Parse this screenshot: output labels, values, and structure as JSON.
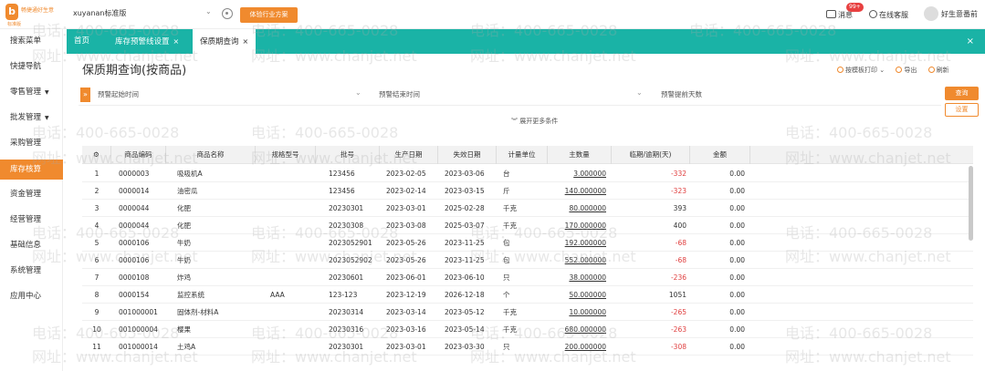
{
  "header": {
    "logo_text": "畅捷通好生意",
    "logo_sub": "标准版",
    "account": "xuyanan标准版",
    "plan_button": "体验行业方案",
    "messages_label": "消息",
    "messages_badge": "99+",
    "online_label": "在线客服",
    "user_label": "好生意番前"
  },
  "sidebar": {
    "items": [
      {
        "label": "搜索菜单"
      },
      {
        "label": "快捷导航"
      },
      {
        "label": "零售管理"
      },
      {
        "label": "批发管理"
      },
      {
        "label": "采购管理"
      },
      {
        "label": "库存核算"
      },
      {
        "label": "资金管理"
      },
      {
        "label": "经营管理"
      },
      {
        "label": "基础信息"
      },
      {
        "label": "系统管理"
      },
      {
        "label": "应用中心"
      }
    ]
  },
  "tabs": {
    "home": "首页",
    "tab1": "库存预警线设置",
    "tab2": "保质期查询",
    "close_glyph": "×"
  },
  "page": {
    "title": "保质期查询(按商品)",
    "print_label": "按模板打印",
    "export_label": "导出",
    "refresh_label": "刷新"
  },
  "filters": {
    "start_time": "预警起始时间",
    "end_time": "预警结束时间",
    "days_ahead": "预警提前天数",
    "query": "查询",
    "settings": "设置",
    "expand": "展开更多条件"
  },
  "table": {
    "headers": [
      "商品编码",
      "商品名称",
      "规格型号",
      "批号",
      "生产日期",
      "失效日期",
      "计量单位",
      "主数量",
      "临期/逾期(天)",
      "金额"
    ],
    "rows": [
      {
        "no": "1",
        "code": "0000003",
        "name": "吸吸机A",
        "spec": "",
        "batch": "123456",
        "mfg": "2023-02-05",
        "exp": "2023-03-06",
        "unit": "台",
        "qty": "3.000000",
        "days": "-332",
        "amount": "0.00"
      },
      {
        "no": "2",
        "code": "0000014",
        "name": "油密瓜",
        "spec": "",
        "batch": "123456",
        "mfg": "2023-02-14",
        "exp": "2023-03-15",
        "unit": "斤",
        "qty": "140.000000",
        "days": "-323",
        "amount": "0.00"
      },
      {
        "no": "3",
        "code": "0000044",
        "name": "化肥",
        "spec": "",
        "batch": "20230301",
        "mfg": "2023-03-01",
        "exp": "2025-02-28",
        "unit": "千克",
        "qty": "80.000000",
        "days": "393",
        "amount": "0.00"
      },
      {
        "no": "4",
        "code": "0000044",
        "name": "化肥",
        "spec": "",
        "batch": "20230308",
        "mfg": "2023-03-08",
        "exp": "2025-03-07",
        "unit": "千克",
        "qty": "170.000000",
        "days": "400",
        "amount": "0.00"
      },
      {
        "no": "5",
        "code": "0000106",
        "name": "牛奶",
        "spec": "",
        "batch": "2023052901",
        "mfg": "2023-05-26",
        "exp": "2023-11-25",
        "unit": "包",
        "qty": "192.000000",
        "days": "-68",
        "amount": "0.00"
      },
      {
        "no": "6",
        "code": "0000106",
        "name": "牛奶",
        "spec": "",
        "batch": "2023052902",
        "mfg": "2023-05-26",
        "exp": "2023-11-25",
        "unit": "包",
        "qty": "552.000000",
        "days": "-68",
        "amount": "0.00"
      },
      {
        "no": "7",
        "code": "0000108",
        "name": "炸鸡",
        "spec": "",
        "batch": "20230601",
        "mfg": "2023-06-01",
        "exp": "2023-06-10",
        "unit": "只",
        "qty": "38.000000",
        "days": "-236",
        "amount": "0.00"
      },
      {
        "no": "8",
        "code": "0000154",
        "name": "监控系统",
        "spec": "AAA",
        "batch": "123-123",
        "mfg": "2023-12-19",
        "exp": "2026-12-18",
        "unit": "个",
        "qty": "50.000000",
        "days": "1051",
        "amount": "0.00"
      },
      {
        "no": "9",
        "code": "001000001",
        "name": "固体剂-材料A",
        "spec": "",
        "batch": "20230314",
        "mfg": "2023-03-14",
        "exp": "2023-05-12",
        "unit": "千克",
        "qty": "10.000000",
        "days": "-265",
        "amount": "0.00"
      },
      {
        "no": "10",
        "code": "001000004",
        "name": "樱果",
        "spec": "",
        "batch": "20230316",
        "mfg": "2023-03-16",
        "exp": "2023-05-14",
        "unit": "千克",
        "qty": "680.000000",
        "days": "-263",
        "amount": "0.00"
      },
      {
        "no": "11",
        "code": "001000014",
        "name": "土鸡A",
        "spec": "",
        "batch": "20230301",
        "mfg": "2023-03-01",
        "exp": "2023-03-30",
        "unit": "只",
        "qty": "200.000000",
        "days": "-308",
        "amount": "0.00"
      }
    ]
  },
  "watermark": {
    "phone": "电话：400-665-0028",
    "url": "网址：www.chanjet.net"
  }
}
